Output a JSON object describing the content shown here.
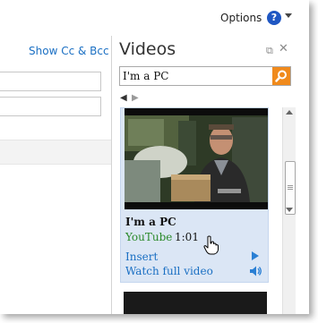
{
  "topbar": {
    "options_label": "Options",
    "help_glyph": "?"
  },
  "compose": {
    "show_cc_bcc": "Show Cc & Bcc"
  },
  "videos_pane": {
    "title": "Videos",
    "search": {
      "value": "I'm a PC",
      "placeholder": ""
    },
    "results": [
      {
        "title": "I'm a PC",
        "source": "YouTube",
        "duration": "1:01",
        "insert_label": "Insert",
        "watch_label": "Watch full video"
      }
    ]
  },
  "colors": {
    "link": "#1a6fc3",
    "source_green": "#2b8a2b",
    "search_button": "#f08a1c",
    "card_bg": "#dbe6f5",
    "help_blue": "#1f57c3"
  },
  "icons": [
    "help-icon",
    "popout-icon",
    "close-icon",
    "search-icon",
    "prev-arrow-icon",
    "next-arrow-icon",
    "play-icon",
    "speaker-icon",
    "hand-cursor-icon"
  ]
}
